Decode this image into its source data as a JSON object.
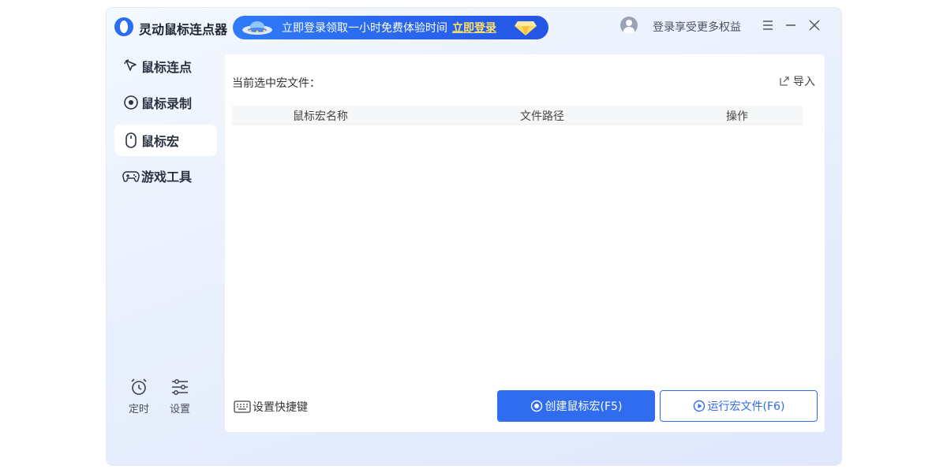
{
  "app": {
    "title": "灵动鼠标连点器"
  },
  "promo": {
    "text": "立即登录领取一小时免费体验时间",
    "link": "立即登录"
  },
  "header": {
    "login_text": "登录享受更多权益"
  },
  "sidebar": {
    "items": [
      {
        "label": "鼠标连点",
        "icon": "cursor-click-icon",
        "active": false
      },
      {
        "label": "鼠标录制",
        "icon": "record-icon",
        "active": false
      },
      {
        "label": "鼠标宏",
        "icon": "mouse-icon",
        "active": true
      },
      {
        "label": "游戏工具",
        "icon": "gamepad-icon",
        "active": false
      }
    ],
    "tools": [
      {
        "label": "定时",
        "icon": "alarm-clock-icon"
      },
      {
        "label": "设置",
        "icon": "sliders-icon"
      }
    ]
  },
  "main": {
    "current_file_label": "当前选中宏文件：",
    "import_label": "导入",
    "columns": [
      "鼠标宏名称",
      "文件路径",
      "操作"
    ],
    "rows": [],
    "shortcut_label": "设置快捷键",
    "create_button": "创建鼠标宏(F5)",
    "run_button": "运行宏文件(F6)"
  },
  "colors": {
    "accent": "#2f6cf0",
    "promo_link": "#ffe066"
  }
}
